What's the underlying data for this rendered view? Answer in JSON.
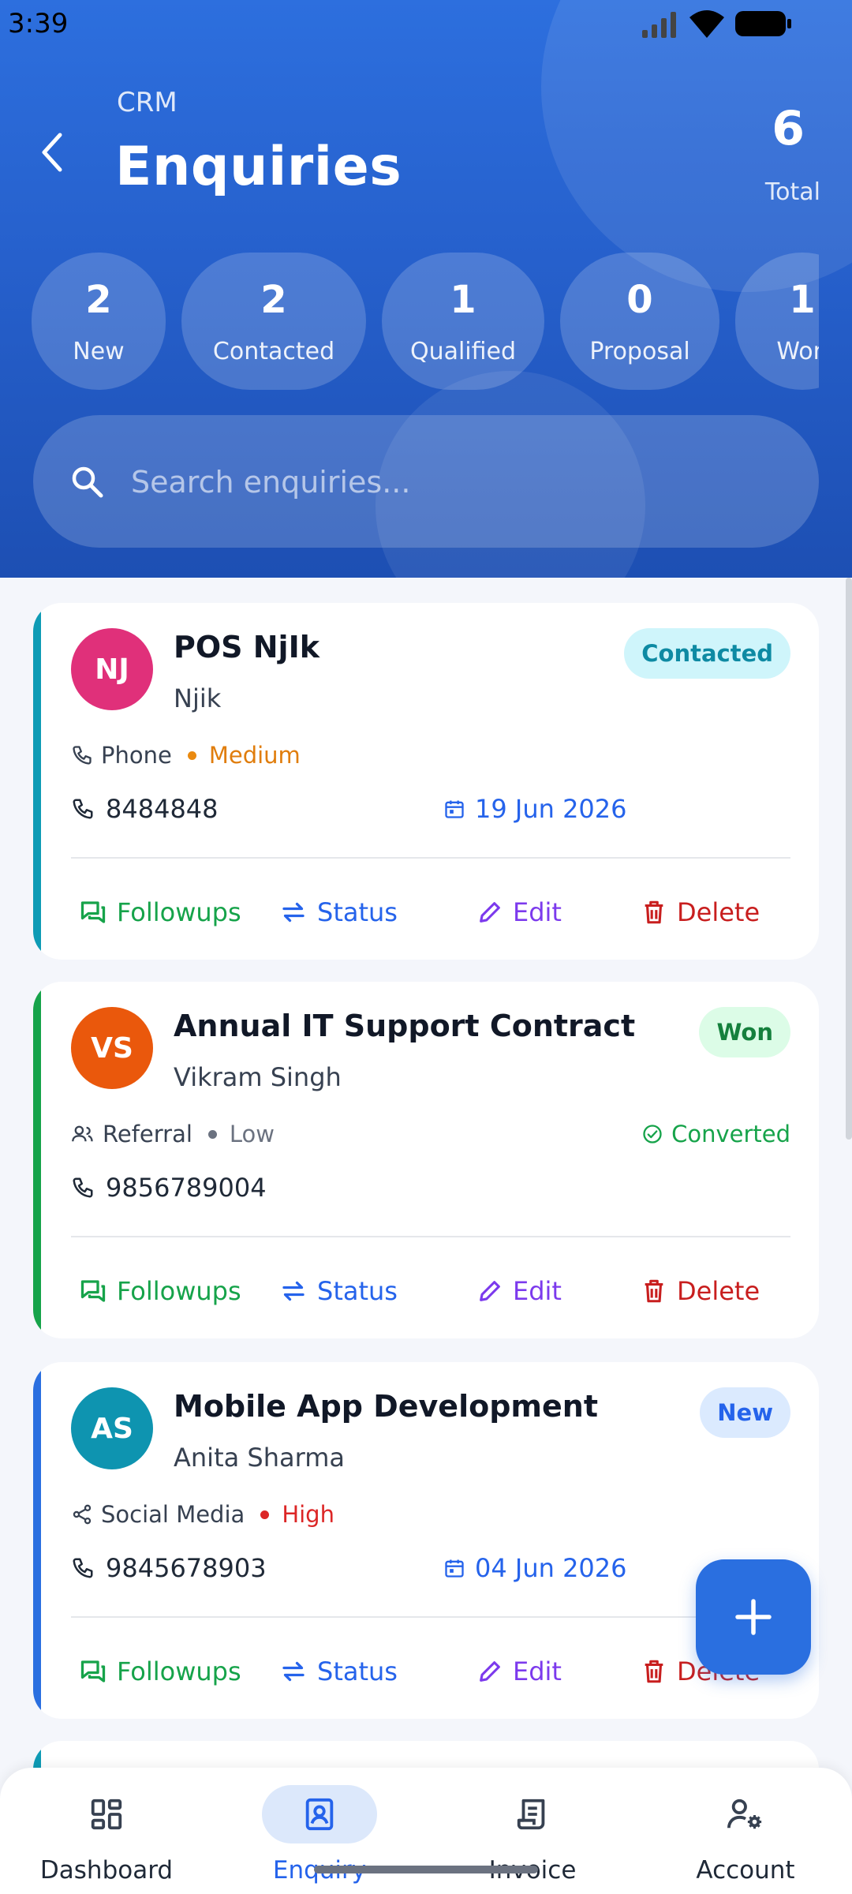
{
  "status_bar": {
    "time": "3:39"
  },
  "header": {
    "section": "CRM",
    "title": "Enquiries",
    "total_count": "6",
    "total_label": "Total"
  },
  "stats": [
    {
      "count": "2",
      "label": "New"
    },
    {
      "count": "2",
      "label": "Contacted"
    },
    {
      "count": "1",
      "label": "Qualified"
    },
    {
      "count": "0",
      "label": "Proposal"
    },
    {
      "count": "1",
      "label": "Won"
    }
  ],
  "search": {
    "placeholder": "Search enquiries..."
  },
  "actions": {
    "followups": "Followups",
    "status": "Status",
    "edit": "Edit",
    "delete": "Delete"
  },
  "enquiries": [
    {
      "initials": "NJ",
      "title": "POS NjIk",
      "contact": "Njik",
      "badge": "Contacted",
      "source": "Phone",
      "priority": "Medium",
      "phone": "8484848",
      "date": "19 Jun 2026"
    },
    {
      "initials": "VS",
      "title": "Annual IT Support Contract",
      "contact": "Vikram Singh",
      "badge": "Won",
      "source": "Referral",
      "priority": "Low",
      "converted": "Converted",
      "phone": "9856789004"
    },
    {
      "initials": "AS",
      "title": "Mobile App Development",
      "contact": "Anita Sharma",
      "badge": "New",
      "source": "Social Media",
      "priority": "High",
      "phone": "9845678903",
      "date": "04 Jun 2026"
    }
  ],
  "colors": {
    "header": "#2660cc",
    "contacted_accent": "#0e9bb5",
    "won_accent": "#16a34a",
    "new_accent": "#2a6fe0",
    "avatar_nj": "#e0307a",
    "avatar_vs": "#ea580c",
    "avatar_as": "#0e94b0",
    "followups": "#16a34a",
    "status": "#2563eb",
    "edit": "#7c3aed",
    "delete": "#c81e1e"
  },
  "bottom_nav": {
    "dashboard": "Dashboard",
    "enquiry": "Enquiry",
    "invoice": "Invoice",
    "account": "Account"
  }
}
